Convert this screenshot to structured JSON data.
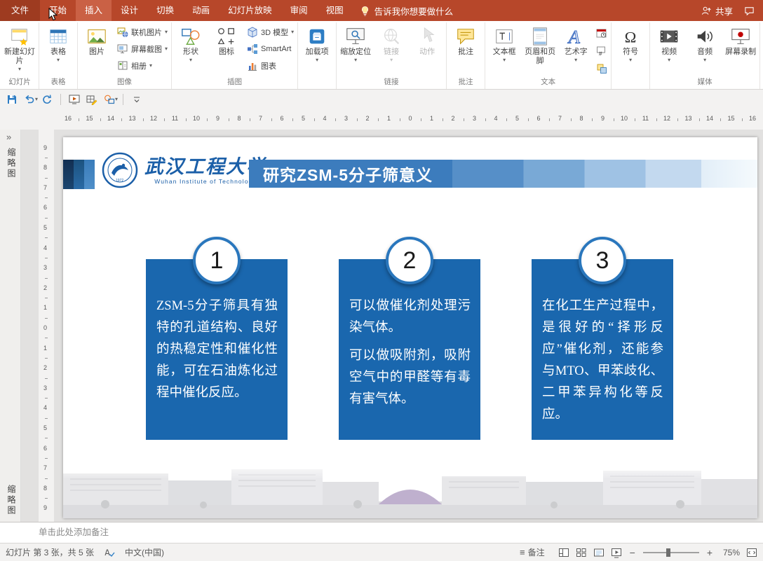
{
  "titlebar": {
    "tabs": [
      {
        "label": "文件",
        "active": false
      },
      {
        "label": "开始",
        "active": false
      },
      {
        "label": "插入",
        "active": true
      },
      {
        "label": "设计",
        "active": false
      },
      {
        "label": "切换",
        "active": false
      },
      {
        "label": "动画",
        "active": false
      },
      {
        "label": "幻灯片放映",
        "active": false
      },
      {
        "label": "审阅",
        "active": false
      },
      {
        "label": "视图",
        "active": false
      }
    ],
    "tell_me": "告诉我你想要做什么",
    "share": "共享"
  },
  "ribbon": {
    "groups": [
      {
        "label": "幻灯片",
        "buttons": [
          {
            "label": "新建幻灯片",
            "icon": "new-slide",
            "type": "large",
            "dropdown": true
          }
        ]
      },
      {
        "label": "表格",
        "buttons": [
          {
            "label": "表格",
            "icon": "table",
            "type": "large",
            "dropdown": true
          }
        ]
      },
      {
        "label": "图像",
        "buttons": [
          {
            "label": "图片",
            "icon": "picture",
            "type": "large"
          },
          {
            "label": "联机图片",
            "icon": "online-pictures",
            "type": "small",
            "dropdown": true
          },
          {
            "label": "屏幕截图",
            "icon": "screenshot",
            "type": "small",
            "dropdown": true
          },
          {
            "label": "相册",
            "icon": "photo-album",
            "type": "small",
            "dropdown": true
          }
        ]
      },
      {
        "label": "插图",
        "buttons": [
          {
            "label": "形状",
            "icon": "shapes",
            "type": "large",
            "dropdown": true
          },
          {
            "label": "图标",
            "icon": "icons",
            "type": "large"
          },
          {
            "label": "3D 模型",
            "icon": "3d-models",
            "type": "small",
            "dropdown": true
          },
          {
            "label": "SmartArt",
            "icon": "smartart",
            "type": "small"
          },
          {
            "label": "图表",
            "icon": "chart",
            "type": "small"
          }
        ]
      },
      {
        "label": "",
        "buttons": [
          {
            "label": "加载项",
            "icon": "add-ins",
            "type": "large",
            "dropdown": true
          }
        ]
      },
      {
        "label": "链接",
        "buttons": [
          {
            "label": "缩放定位",
            "icon": "zoom",
            "type": "large",
            "dropdown": true
          },
          {
            "label": "链接",
            "icon": "link",
            "type": "large",
            "dropdown": true,
            "disabled": true
          },
          {
            "label": "动作",
            "icon": "action",
            "type": "large",
            "disabled": true
          }
        ]
      },
      {
        "label": "批注",
        "buttons": [
          {
            "label": "批注",
            "icon": "comment",
            "type": "large"
          }
        ]
      },
      {
        "label": "文本",
        "buttons": [
          {
            "label": "文本框",
            "icon": "text-box",
            "type": "large",
            "dropdown": true
          },
          {
            "label": "页眉和页脚",
            "icon": "header-footer",
            "type": "large"
          },
          {
            "label": "艺术字",
            "icon": "wordart",
            "type": "large",
            "dropdown": true
          },
          {
            "type": "stack",
            "icons": [
              {
                "name": "date-time"
              },
              {
                "name": "slide-number"
              },
              {
                "name": "object"
              }
            ]
          }
        ]
      },
      {
        "label": "",
        "buttons": [
          {
            "label": "符号",
            "icon": "symbol",
            "type": "large",
            "dropdown": true
          }
        ]
      },
      {
        "label": "媒体",
        "buttons": [
          {
            "label": "视频",
            "icon": "video",
            "type": "large",
            "dropdown": true
          },
          {
            "label": "音频",
            "icon": "audio",
            "type": "large",
            "dropdown": true
          },
          {
            "label": "屏幕录制",
            "icon": "screen-recording",
            "type": "large"
          }
        ]
      }
    ]
  },
  "qat": {
    "buttons": [
      {
        "name": "save"
      },
      {
        "name": "undo",
        "dropdown": true
      },
      {
        "name": "redo"
      },
      {
        "name": "start-slideshow"
      },
      {
        "name": "draw-table"
      },
      {
        "name": "shape-tools",
        "dropdown": true
      },
      {
        "name": "qat-more"
      }
    ]
  },
  "ruler": {
    "horizontal_max": 16,
    "vertical_max": 9
  },
  "thumbnail_pane": {
    "expand": "»",
    "label": "缩略图",
    "label_bottom": "缩略图"
  },
  "slide": {
    "logo": {
      "title": "武汉工程大学",
      "subtitle": "Wuhan Institute of Technology"
    },
    "title": "研究ZSM-5分子筛意义",
    "items": [
      {
        "number": "1",
        "paragraphs": [
          "ZSM-5分子筛具有独特的孔道结构、良好的热稳定性和催化性能，可在石油炼化过程中催化反应。"
        ]
      },
      {
        "number": "2",
        "paragraphs": [
          "可以做催化剂处理污染气体。",
          "可以做吸附剂，吸附空气中的甲醛等有毒有害气体。"
        ]
      },
      {
        "number": "3",
        "paragraphs": [
          "在化工生产过程中，是很好的“择形反应”催化剂，还能参与MTO、甲苯歧化、二甲苯异构化等反应。"
        ]
      }
    ]
  },
  "notes": {
    "placeholder": "单击此处添加备注"
  },
  "statusbar": {
    "slide_indicator": "幻灯片 第 3 张，共 5 张",
    "language": "中文(中国)",
    "notes_icon": "≡",
    "notes_button": "备注",
    "zoom_out": "−",
    "zoom_in": "+",
    "zoom_level": "75%"
  },
  "colors": {
    "ribbon_red": "#b7472a",
    "accent_blue": "#1a67ae",
    "banner_blue": "#3c7cbd"
  }
}
